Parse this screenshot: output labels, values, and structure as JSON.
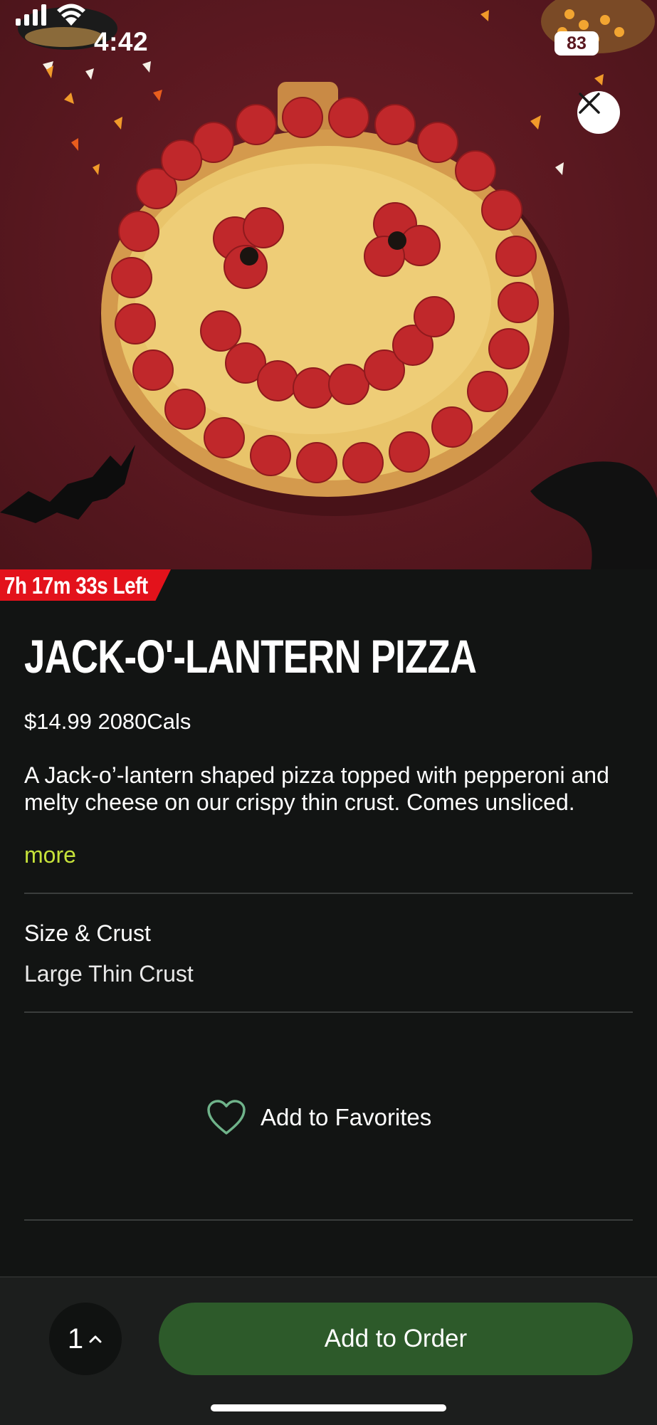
{
  "status_bar": {
    "time": "4:42",
    "battery": "83"
  },
  "hero": {
    "image_alt": "Jack-o'-lantern shaped pepperoni pizza on a dark red background with candy corn"
  },
  "timer": {
    "text": "7h 17m 33s Left"
  },
  "product": {
    "title": "JACK-O'-LANTERN PIZZA",
    "price": "$14.99",
    "calories": "2080Cals",
    "description": "A Jack-o’-lantern shaped pizza topped with pepperoni and melty cheese on our crispy thin crust. Comes unsliced.",
    "more_label": "more"
  },
  "options": {
    "label": "Size & Crust",
    "value": "Large Thin Crust"
  },
  "favorites": {
    "label": "Add to Favorites"
  },
  "order": {
    "quantity": "1",
    "button_label": "Add to Order"
  },
  "colors": {
    "background": "#121413",
    "hero_bg": "#5a1820",
    "timer_bg": "#e3121b",
    "accent_more": "#c6e23a",
    "primary_button": "#2d5a2a",
    "heart_icon": "#6fb38a"
  }
}
